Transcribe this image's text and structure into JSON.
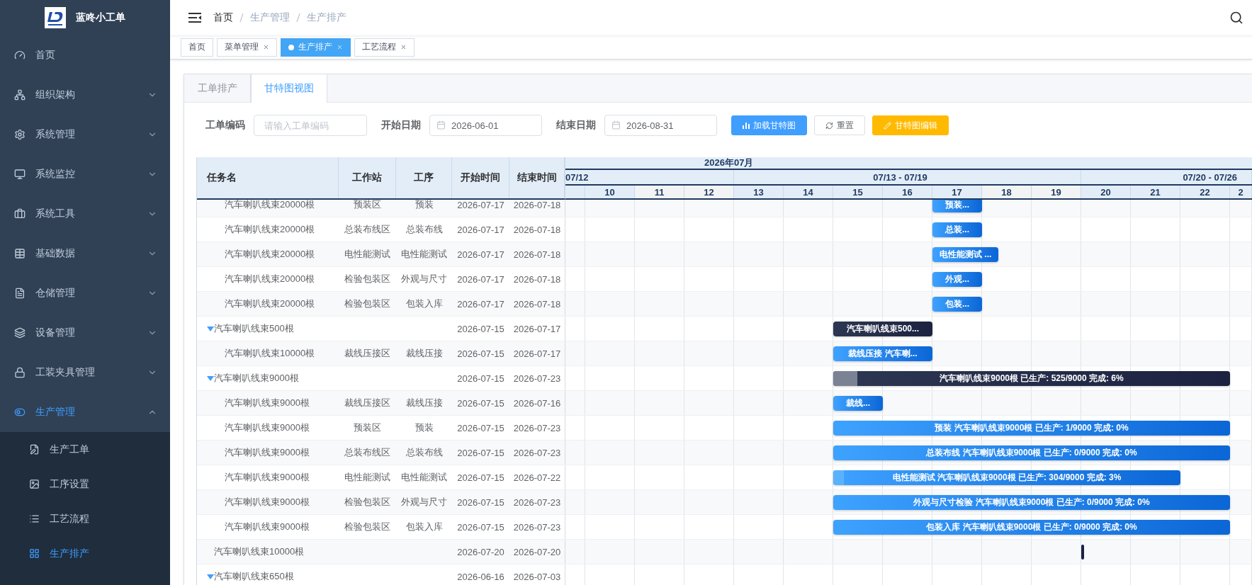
{
  "sidebar": {
    "brand": "蓝咚小工单",
    "items": [
      {
        "label": "首页",
        "kind": "link",
        "selected": false
      },
      {
        "label": "组织架构",
        "kind": "menu",
        "expanded": false,
        "selected": false
      },
      {
        "label": "系统管理",
        "kind": "menu",
        "expanded": false,
        "selected": false
      },
      {
        "label": "系统监控",
        "kind": "menu",
        "expanded": false,
        "selected": false
      },
      {
        "label": "系统工具",
        "kind": "menu",
        "expanded": false,
        "selected": false
      },
      {
        "label": "基础数据",
        "kind": "menu",
        "expanded": false,
        "selected": false
      },
      {
        "label": "仓储管理",
        "kind": "menu",
        "expanded": false,
        "selected": false
      },
      {
        "label": "设备管理",
        "kind": "menu",
        "expanded": false,
        "selected": false
      },
      {
        "label": "工装夹具管理",
        "kind": "menu",
        "expanded": false,
        "selected": false
      },
      {
        "label": "生产管理",
        "kind": "menu",
        "expanded": true,
        "selected": true,
        "children": [
          {
            "label": "生产工单",
            "selected": false
          },
          {
            "label": "工序设置",
            "selected": false
          },
          {
            "label": "工艺流程",
            "selected": false
          },
          {
            "label": "生产排产",
            "selected": true
          }
        ]
      }
    ]
  },
  "breadcrumb": [
    {
      "label": "首页",
      "current": true
    },
    {
      "label": "生产管理",
      "current": false
    },
    {
      "label": "生产排产",
      "current": false
    }
  ],
  "tags": [
    {
      "label": "首页",
      "selected": false,
      "closable": false
    },
    {
      "label": "菜单管理",
      "selected": false,
      "closable": true
    },
    {
      "label": "生产排产",
      "selected": true,
      "closable": true
    },
    {
      "label": "工艺流程",
      "selected": false,
      "closable": true
    }
  ],
  "tabs": [
    {
      "label": "工单排产",
      "selected": false
    },
    {
      "label": "甘特图视图",
      "selected": true
    }
  ],
  "filters": [
    {
      "label": "工单编码",
      "kind": "text",
      "placeholder": "请输入工单编码"
    },
    {
      "label": "开始日期",
      "kind": "date",
      "value": "2026-06-01"
    },
    {
      "label": "结束日期",
      "kind": "date",
      "value": "2026-08-31"
    }
  ],
  "buttons": [
    {
      "label": "加载甘特图",
      "kind": "primary"
    },
    {
      "label": "重置",
      "kind": "default"
    },
    {
      "label": "甘特图编辑",
      "kind": "warning"
    }
  ],
  "gantt": {
    "columns": [
      "任务名",
      "工作站",
      "工序",
      "开始时间",
      "结束时间"
    ],
    "month": "2026年07月",
    "weeks": [
      "07/12",
      "07/13 - 07/19",
      "07/20 - 07/26"
    ],
    "days": [
      {
        "label": "10",
        "weekend": false
      },
      {
        "label": "11",
        "weekend": true
      },
      {
        "label": "12",
        "weekend": true
      },
      {
        "label": "13",
        "weekend": false
      },
      {
        "label": "14",
        "weekend": false
      },
      {
        "label": "15",
        "weekend": false
      },
      {
        "label": "16",
        "weekend": false
      },
      {
        "label": "17",
        "weekend": false
      },
      {
        "label": "18",
        "weekend": true
      },
      {
        "label": "19",
        "weekend": true
      },
      {
        "label": "20",
        "weekend": false
      },
      {
        "label": "21",
        "weekend": false
      },
      {
        "label": "22",
        "weekend": false
      },
      {
        "label": "2",
        "weekend": false
      }
    ],
    "rows": [
      {
        "children": [
          {
            "task": "汽车喇叭线束20000根",
            "station": "预装区",
            "process": "预装",
            "start": "2026-07-17",
            "end": "2026-07-18",
            "bar": {
              "kind": "task",
              "label": "预装..."
            }
          },
          {
            "task": "汽车喇叭线束20000根",
            "station": "总装布线区",
            "process": "总装布线",
            "start": "2026-07-17",
            "end": "2026-07-18",
            "bar": {
              "kind": "task",
              "label": "总装..."
            }
          },
          {
            "task": "汽车喇叭线束20000根",
            "station": "电性能测试",
            "process": "电性能测试",
            "start": "2026-07-17",
            "end": "2026-07-18",
            "bar": {
              "kind": "task",
              "label": "电性能测试 ..."
            }
          },
          {
            "task": "汽车喇叭线束20000根",
            "station": "检验包装区",
            "process": "外观与尺寸",
            "start": "2026-07-17",
            "end": "2026-07-18",
            "bar": {
              "kind": "task",
              "label": "外观..."
            }
          },
          {
            "task": "汽车喇叭线束20000根",
            "station": "检验包装区",
            "process": "包装入库",
            "start": "2026-07-17",
            "end": "2026-07-18",
            "bar": {
              "kind": "task",
              "label": "包装..."
            }
          }
        ]
      },
      {
        "task": "汽车喇叭线束500根",
        "kind": "group",
        "expanded": true,
        "start": "2026-07-15",
        "end": "2026-07-17",
        "bar": {
          "kind": "summary",
          "label": "汽车喇叭线束500..."
        },
        "children": [
          {
            "task": "汽车喇叭线束10000根",
            "station": "裁线压接区",
            "process": "裁线压接",
            "start": "2026-07-15",
            "end": "2026-07-17",
            "bar": {
              "kind": "task",
              "label": "裁线压接 汽车喇..."
            }
          }
        ]
      },
      {
        "task": "汽车喇叭线束9000根",
        "kind": "group",
        "expanded": true,
        "start": "2026-07-15",
        "end": "2026-07-23",
        "bar": {
          "kind": "summary",
          "label": "汽车喇叭线束9000根 已生产: 525/9000 完成: 6%",
          "level": 0.06
        },
        "children": [
          {
            "task": "汽车喇叭线束9000根",
            "station": "裁线压接区",
            "process": "裁线压接",
            "start": "2026-07-15",
            "end": "2026-07-16",
            "bar": {
              "kind": "task",
              "label": "裁线..."
            }
          },
          {
            "task": "汽车喇叭线束9000根",
            "station": "预装区",
            "process": "预装",
            "start": "2026-07-15",
            "end": "2026-07-23",
            "bar": {
              "kind": "task",
              "label": "预装 汽车喇叭线束9000根 已生产: 1/9000 完成: 0%",
              "level": 0
            }
          },
          {
            "task": "汽车喇叭线束9000根",
            "station": "总装布线区",
            "process": "总装布线",
            "start": "2026-07-15",
            "end": "2026-07-23",
            "bar": {
              "kind": "task",
              "label": "总装布线 汽车喇叭线束9000根 已生产: 0/9000 完成: 0%",
              "level": 0
            }
          },
          {
            "task": "汽车喇叭线束9000根",
            "station": "电性能测试",
            "process": "电性能测试",
            "start": "2026-07-15",
            "end": "2026-07-22",
            "bar": {
              "kind": "task",
              "label": "电性能测试 汽车喇叭线束9000根 已生产: 304/9000 完成: 3%",
              "level": 0.03
            }
          },
          {
            "task": "汽车喇叭线束9000根",
            "station": "检验包装区",
            "process": "外观与尺寸",
            "start": "2026-07-15",
            "end": "2026-07-23",
            "bar": {
              "kind": "task",
              "label": "外观与尺寸检验 汽车喇叭线束9000根 已生产: 0/9000 完成: 0%",
              "level": 0
            }
          },
          {
            "task": "汽车喇叭线束9000根",
            "station": "检验包装区",
            "process": "包装入库",
            "start": "2026-07-15",
            "end": "2026-07-23",
            "bar": {
              "kind": "task",
              "label": "包装入库 汽车喇叭线束9000根 已生产: 0/9000 完成: 0%",
              "level": 0
            }
          }
        ]
      },
      {
        "task": "汽车喇叭线束10000根",
        "kind": "single",
        "start": "2026-07-20",
        "end": "2026-07-20",
        "bar": {
          "kind": "milestone"
        }
      },
      {
        "task": "汽车喇叭线束650根",
        "kind": "group",
        "expanded": true,
        "start": "2026-06-16",
        "end": "2026-07-03"
      }
    ]
  }
}
